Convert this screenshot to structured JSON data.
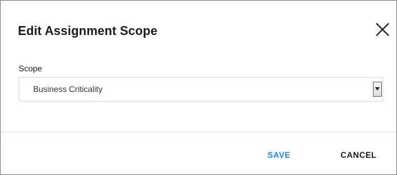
{
  "dialog": {
    "title": "Edit Assignment Scope",
    "close_icon": "close-icon"
  },
  "scope_field": {
    "label": "Scope",
    "selected_value": "Business Criticality",
    "dropdown_icon": "chevron-down-icon"
  },
  "actions": {
    "save_label": "SAVE",
    "cancel_label": "CANCEL"
  },
  "colors": {
    "save": "#1e88e5",
    "text": "#1a1a1a",
    "border": "#dcdcdc"
  }
}
